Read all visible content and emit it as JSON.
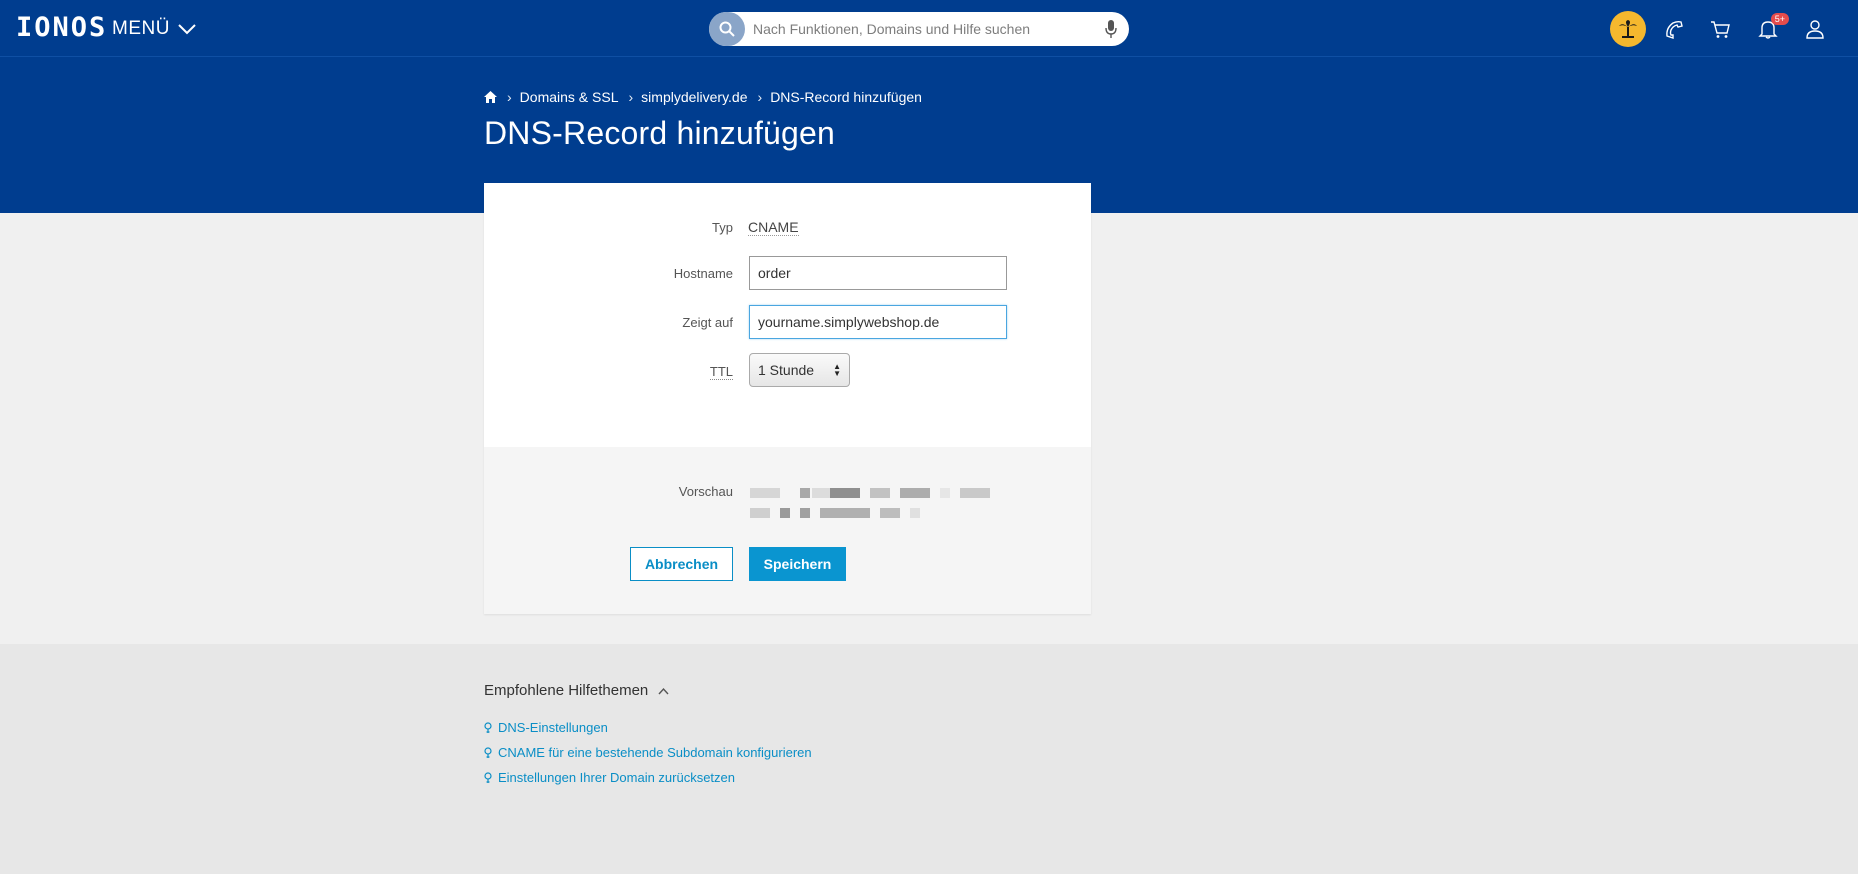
{
  "header": {
    "logo": "IONOS",
    "menu_label": "MENÜ",
    "search_placeholder": "Nach Funktionen, Domains und Hilfe suchen",
    "notification_badge": "5+",
    "icons": [
      "palm-tree-icon",
      "phone-icon",
      "cart-icon",
      "bell-icon",
      "user-icon"
    ]
  },
  "breadcrumb": {
    "items": [
      "Domains & SSL",
      "simplydelivery.de",
      "DNS-Record hinzufügen"
    ]
  },
  "page_title": "DNS-Record hinzufügen",
  "form": {
    "type_label": "Typ",
    "type_value": "CNAME",
    "hostname_label": "Hostname",
    "hostname_value": "order",
    "points_to_label": "Zeigt auf",
    "points_to_value": "yourname.simplywebshop.de",
    "ttl_label": "TTL",
    "ttl_value": "1 Stunde",
    "preview_label": "Vorschau",
    "cancel_label": "Abbrechen",
    "save_label": "Speichern"
  },
  "help": {
    "title": "Empfohlene Hilfethemen",
    "links": [
      "DNS-Einstellungen",
      "CNAME für eine bestehende Subdomain konfigurieren",
      "Einstellungen Ihrer Domain zurücksetzen"
    ]
  },
  "colors": {
    "brand_blue": "#003d8f",
    "accent": "#0a95d0",
    "avatar_bg": "#f5b82e"
  }
}
